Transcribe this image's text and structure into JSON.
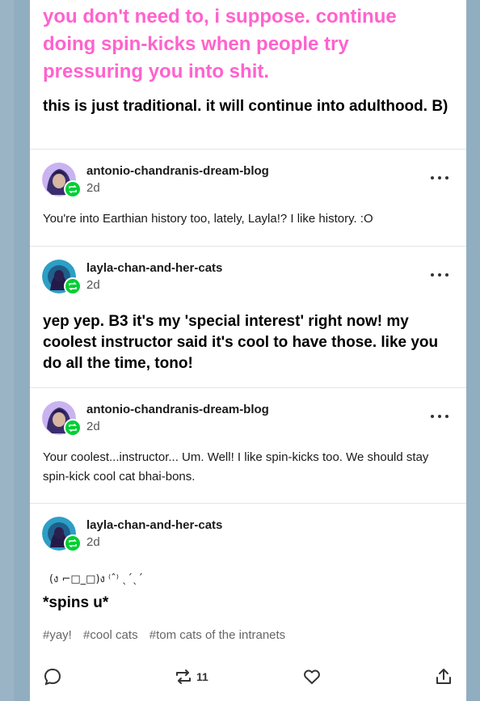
{
  "post": {
    "op_pink_text": "you don't need to, i suppose. continue doing spin-kicks when people try pressuring you into shit.",
    "op_bold_text": "this is just traditional. it will continue into adulthood. B)"
  },
  "reblogs": [
    {
      "username": "antonio-chandranis-dream-blog",
      "time": "2d",
      "text": "You're into Earthian history too, lately, Layla!? I like history.  :O"
    },
    {
      "username": "layla-chan-and-her-cats",
      "time": "2d",
      "text": "yep yep. B3 it's my 'special interest' right now! my coolest instructor said it's cool to have those. like you do all the time, tono!"
    },
    {
      "username": "antonio-chandranis-dream-blog",
      "time": "2d",
      "text": "Your coolest...instructor... Um. Well! I like spin-kicks too. We should stay spin-kick cool cat bhai-bons."
    },
    {
      "username": "layla-chan-and-her-cats",
      "time": "2d",
      "kaomoji": "ㅤ(ง ⌐□_□)ง ⁽ˆ⁾ ˎ´ˎ´",
      "text": "*spins u*"
    }
  ],
  "tags": [
    "#yay!",
    "#cool cats",
    "#tom cats of the intranets"
  ],
  "footer": {
    "notes_count": "11"
  },
  "colors": {
    "background": "#91aec1",
    "pink": "#ff62ce",
    "reblog_green": "#00cf35"
  },
  "icons": [
    "reply-icon",
    "reblog-icon",
    "like-icon",
    "share-icon",
    "more-icon",
    "reblog-badge-icon"
  ]
}
